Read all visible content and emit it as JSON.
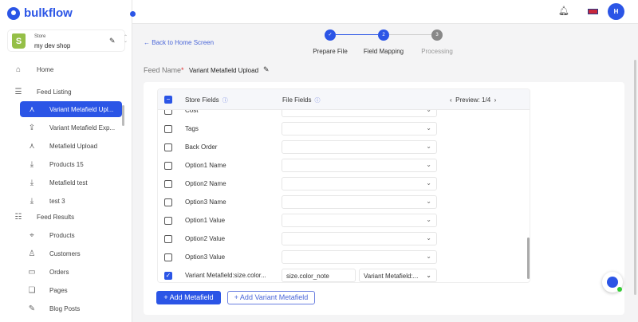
{
  "brand": "bulkflow",
  "store": {
    "label": "Store",
    "name": "my dev shop"
  },
  "nav": [
    {
      "label": "Home",
      "icon": "home-icon"
    },
    {
      "label": "Feed Listing",
      "icon": "list-icon"
    },
    {
      "label": "Variant Metafield Upl...",
      "icon": "upload-icon",
      "active": true
    },
    {
      "label": "Variant Metafield Exp...",
      "icon": "export-icon"
    },
    {
      "label": "Metafield Upload",
      "icon": "upload-icon"
    },
    {
      "label": "Products 15",
      "icon": "download-icon"
    },
    {
      "label": "Metafield test",
      "icon": "download-icon"
    },
    {
      "label": "test 3",
      "icon": "download-icon"
    },
    {
      "label": "Feed Results",
      "icon": "database-icon"
    },
    {
      "label": "Products",
      "icon": "tag-icon"
    },
    {
      "label": "Customers",
      "icon": "user-icon"
    },
    {
      "label": "Orders",
      "icon": "inbox-icon"
    },
    {
      "label": "Pages",
      "icon": "pages-icon"
    },
    {
      "label": "Blog Posts",
      "icon": "edit-icon"
    }
  ],
  "header": {
    "avatar": "H"
  },
  "back": "Back to Home Screen",
  "steps": [
    {
      "num": "✓",
      "label": "Prepare File"
    },
    {
      "num": "2",
      "label": "Field Mapping"
    },
    {
      "num": "3",
      "label": "Processing"
    }
  ],
  "feed": {
    "label": "Feed Name",
    "required": "*",
    "value": "Variant Metafield Upload"
  },
  "table": {
    "store_fields": "Store Fields",
    "file_fields": "File Fields",
    "preview": "Preview: 1/4",
    "rows": [
      "Cost",
      "Tags",
      "Back Order",
      "Option1 Name",
      "Option2 Name",
      "Option3 Name",
      "Option1 Value",
      "Option2 Value",
      "Option3 Value"
    ],
    "meta": {
      "field": "Variant Metafield:size.color...",
      "input": "size.color_note",
      "select": "Variant Metafield:..."
    }
  },
  "buttons": {
    "add_metafield": "+  Add Metafield",
    "add_variant_metafield": "+  Add Variant Metafield"
  }
}
